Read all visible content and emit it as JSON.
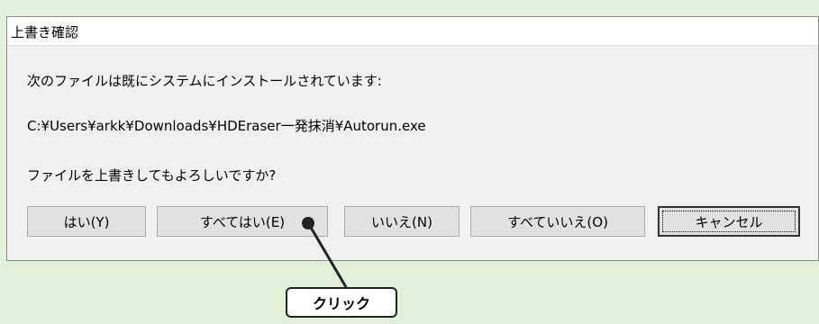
{
  "dialog": {
    "title": "上書き確認",
    "message_line1": "次のファイルは既にシステムにインストールされています:",
    "file_path": "C:¥Users¥arkk¥Downloads¥HDEraser一発抹消¥Autorun.exe",
    "question": "ファイルを上書きしてもよろしいですか?",
    "buttons": {
      "yes": "はい(Y)",
      "yes_all": "すべてはい(E)",
      "no": "いいえ(N)",
      "no_all": "すべていいえ(O)",
      "cancel": "キャンセル"
    }
  },
  "annotation": {
    "callout_label": "クリック"
  },
  "colors": {
    "background": "#e1f0d9",
    "dialog_body": "#f0f0f0",
    "button_face": "#e1e1e1",
    "marker": "#222222"
  }
}
